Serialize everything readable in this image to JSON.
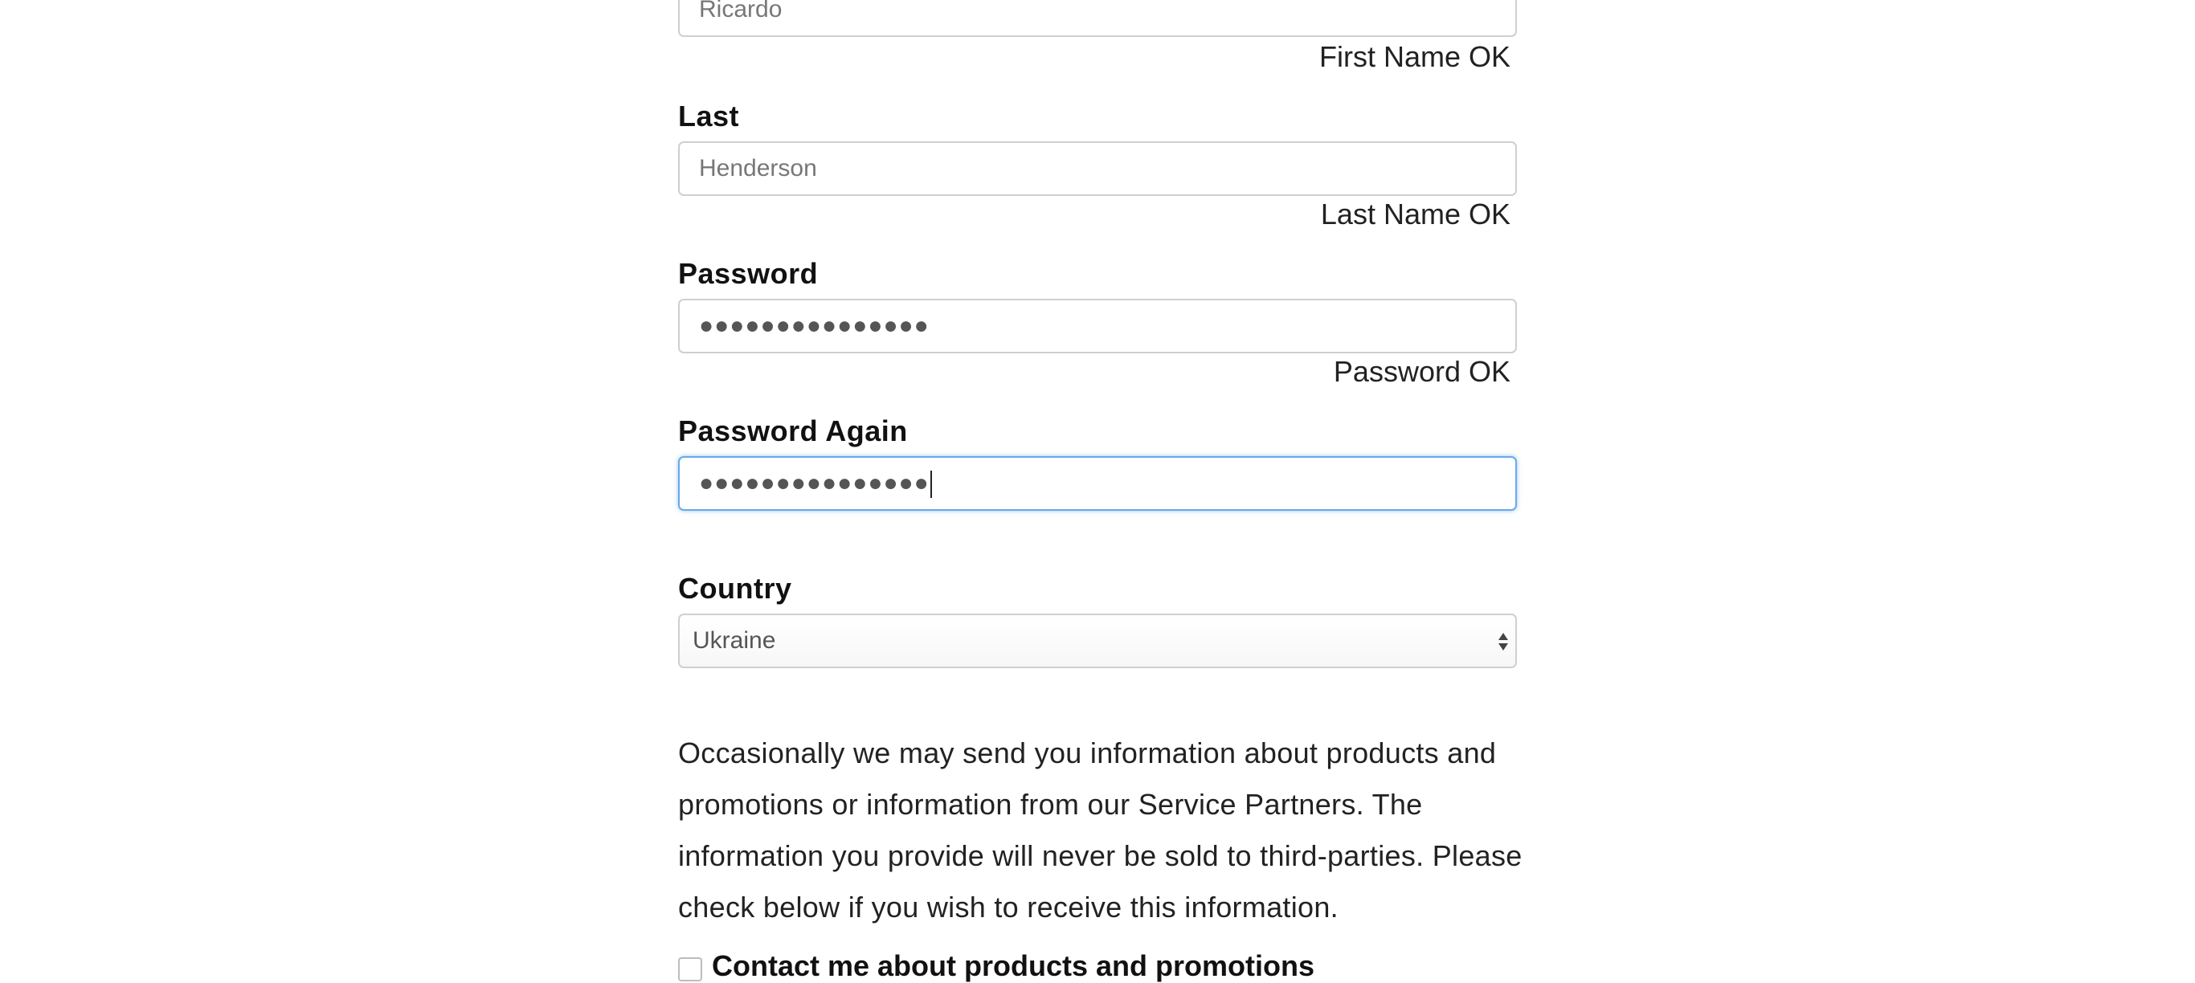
{
  "fields": {
    "first": {
      "value": "Ricardo",
      "status": "First Name OK"
    },
    "last": {
      "label": "Last",
      "value": "Henderson",
      "status": "Last Name OK"
    },
    "password": {
      "label": "Password",
      "value": "●●●●●●●●●●●●●●●",
      "status": "Password OK"
    },
    "password_again": {
      "label": "Password Again",
      "value": "●●●●●●●●●●●●●●●"
    },
    "country": {
      "label": "Country",
      "selected": "Ukraine"
    }
  },
  "info_text": "Occasionally we may send you information about products and promotions or information from our Service Partners. The information you provide will never be sold to third-parties. Please check below if you wish to receive this information.",
  "contact_checkbox": {
    "label": "Contact me about products and promotions",
    "checked": false
  },
  "colors": {
    "focus_border": "#6aa8ea",
    "input_border": "#cfcfcf"
  }
}
